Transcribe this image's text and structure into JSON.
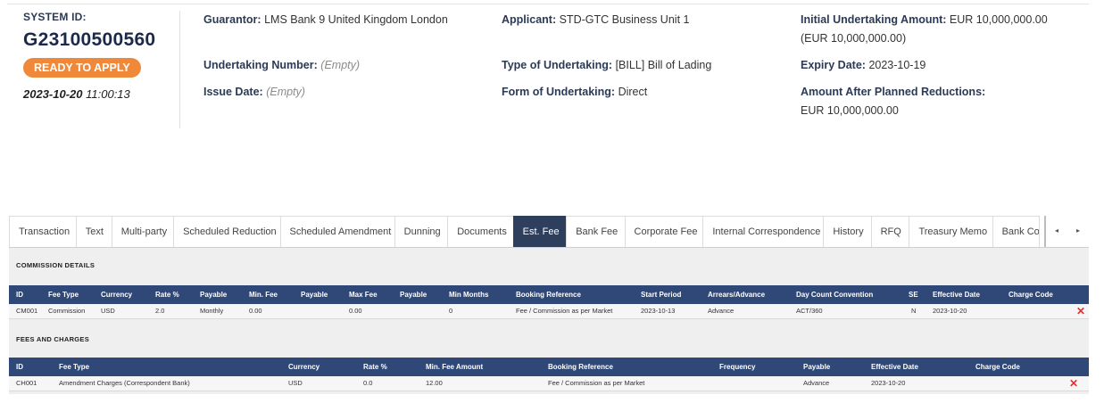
{
  "summary": {
    "system_id_label": "SYSTEM ID:",
    "system_id": "G23100500560",
    "status": "READY TO APPLY",
    "date": "2023-10-20",
    "time": "11:00:13",
    "guarantor_label": "Guarantor:",
    "guarantor": "LMS Bank 9 United Kingdom London",
    "undertaking_number_label": "Undertaking Number:",
    "undertaking_number": "(Empty)",
    "issue_date_label": "Issue Date:",
    "issue_date": "(Empty)",
    "applicant_label": "Applicant:",
    "applicant": "STD-GTC Business Unit 1",
    "type_label": "Type of Undertaking:",
    "type": "[BILL] Bill of Lading",
    "form_label": "Form of Undertaking:",
    "form": "Direct",
    "initial_amount_label": "Initial Undertaking Amount:",
    "initial_amount": "EUR 10,000,000.00",
    "initial_amount_equiv": "(EUR 10,000,000.00)",
    "expiry_label": "Expiry Date:",
    "expiry": "2023-10-19",
    "after_reductions_label": "Amount After Planned Reductions:",
    "after_reductions": "EUR 10,000,000.00"
  },
  "tabs": [
    "Transaction",
    "Text",
    "Multi-party",
    "Scheduled Reduction",
    "Scheduled Amendment",
    "Dunning",
    "Documents",
    "Est. Fee",
    "Bank Fee",
    "Corporate Fee",
    "Internal Correspondence",
    "History",
    "RFQ",
    "Treasury Memo",
    "Bank Corr"
  ],
  "active_tab": "Est. Fee",
  "tab_nav": {
    "prev_icon": "triangle-left",
    "next_icon": "triangle-right",
    "prev": "◂",
    "next": "▸"
  },
  "commission": {
    "title": "COMMISSION DETAILS",
    "headers": [
      "ID",
      "Fee Type",
      "Currency",
      "Rate %",
      "Payable",
      "Min. Fee",
      "Payable",
      "Max Fee",
      "Payable",
      "Min Months",
      "Booking Reference",
      "Start Period",
      "Arrears/Advance",
      "Day Count Convention",
      "SE",
      "Effective Date",
      "Charge Code"
    ],
    "rows": [
      [
        "CM001",
        "Commission",
        "USD",
        "2.0",
        "Monthly",
        "0.00",
        "",
        "0.00",
        "",
        "0",
        "Fee / Commission as per Market",
        "2023-10-13",
        "Advance",
        "ACT/360",
        "N",
        "2023-10-20",
        ""
      ]
    ]
  },
  "fees": {
    "title": "FEES AND CHARGES",
    "headers": [
      "ID",
      "Fee Type",
      "Currency",
      "Rate %",
      "Min. Fee Amount",
      "Booking Reference",
      "Frequency",
      "Payable",
      "Effective Date",
      "Charge Code"
    ],
    "rows": [
      [
        "CH001",
        "Amendment Charges (Correspondent Bank)",
        "USD",
        "0.0",
        "12.00",
        "Fee / Commission as per Market",
        "",
        "Advance",
        "2023-10-20",
        ""
      ]
    ]
  },
  "delete_icon": "✕",
  "colors": {
    "accent": "#f0883a",
    "header_bg": "#2f4878",
    "active_tab": "#2d3f5c",
    "delete": "#e53030"
  }
}
